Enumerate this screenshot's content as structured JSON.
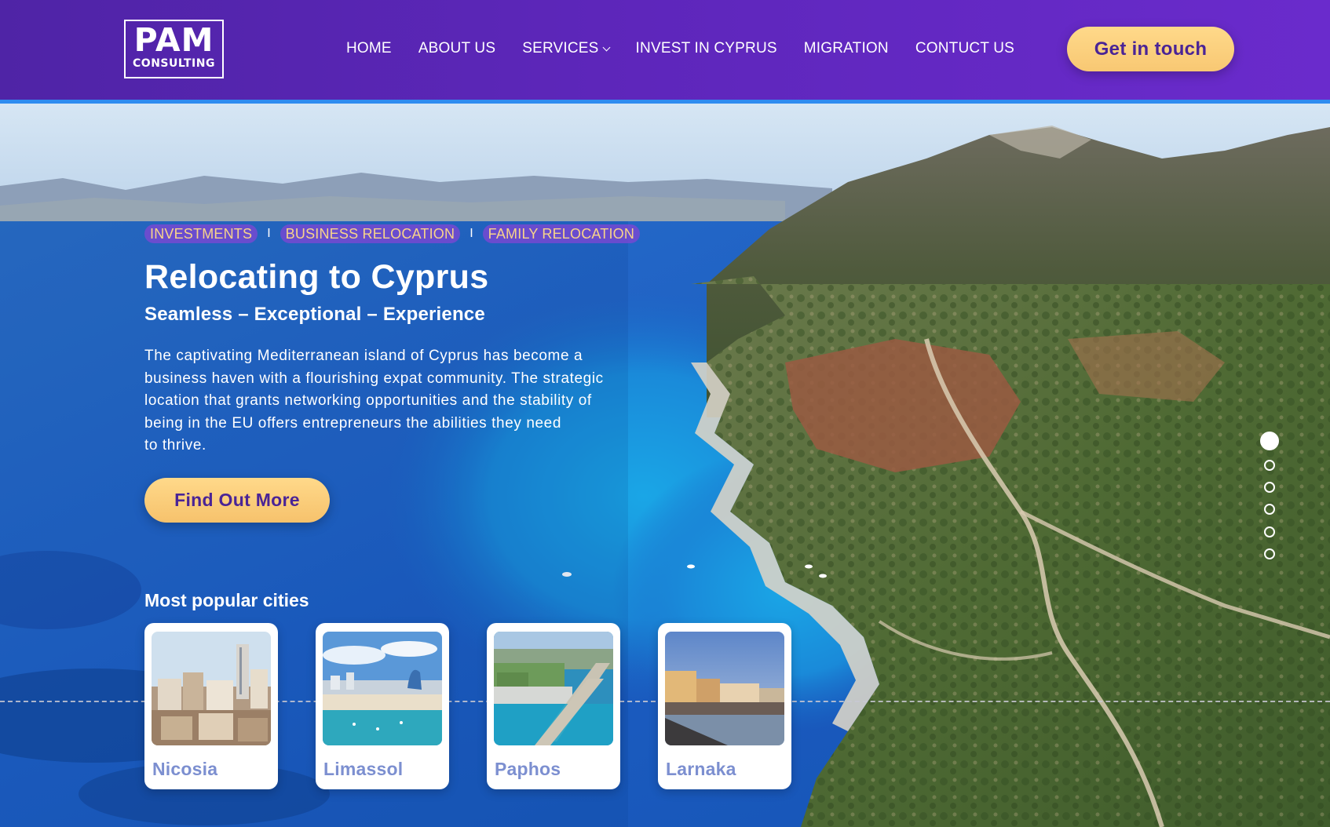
{
  "header": {
    "logo_big": "PAM",
    "logo_small": "CONSULTING",
    "nav": [
      {
        "label": "HOME"
      },
      {
        "label": "ABOUT US"
      },
      {
        "label": "SERVICES"
      },
      {
        "label": "INVEST IN CYPRUS"
      },
      {
        "label": "MIGRATION"
      },
      {
        "label": "CONTUCT US"
      }
    ],
    "services_icon": "chevron-down-icon",
    "cta_label": "Get in touch"
  },
  "hero": {
    "tags": [
      "INVESTMENTS",
      "BUSINESS RELOCATION",
      "FAMILY RELOCATION"
    ],
    "tag_separator": "I",
    "title": "Relocating to Cyprus",
    "subtitle": "Seamless – Exceptional – Experience",
    "body_lines": [
      "The captivating Mediterranean island of Cyprus has become a",
      "business haven with a flourishing expat community. The strategic",
      "location that grants networking opportunities and the stability of",
      "being in the EU offers entrepreneurs the abilities they need",
      "to thrive."
    ],
    "button_label": "Find Out More"
  },
  "cities": {
    "title": "Most popular cities",
    "items": [
      {
        "name": "Nicosia"
      },
      {
        "name": "Limassol"
      },
      {
        "name": "Paphos"
      },
      {
        "name": "Larnaka"
      }
    ]
  },
  "slider": {
    "total": 6,
    "active": 1
  },
  "colors": {
    "header_purple": "#5d26ba",
    "accent_yellow": "#f8c873",
    "button_text": "#4a2496",
    "city_text": "#7c8fd0",
    "tag_bg": "#7e46d2",
    "tag_text": "#f8d48a"
  }
}
